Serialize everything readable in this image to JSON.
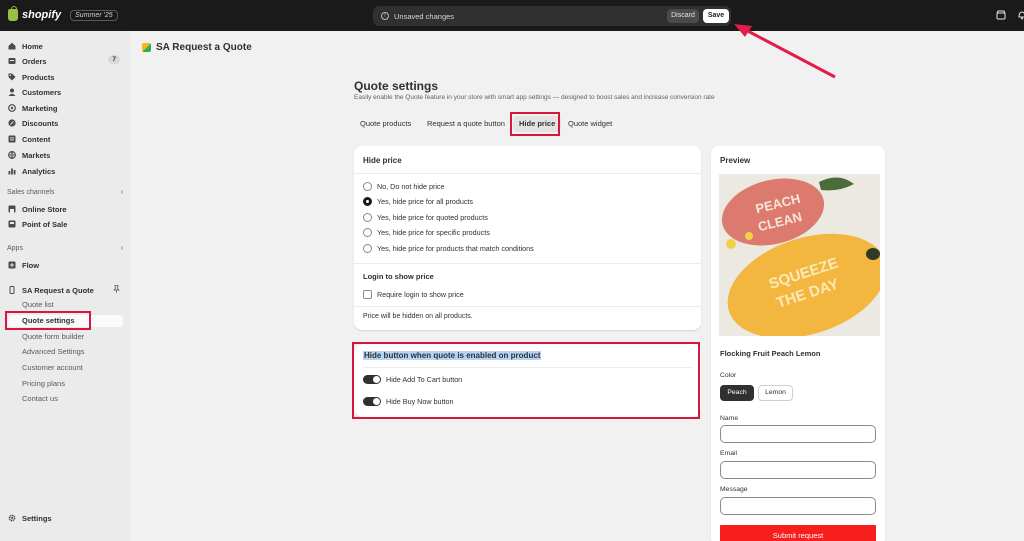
{
  "topbar": {
    "brand": "shopify",
    "season": "Summer '25",
    "unsaved": "Unsaved changes",
    "discard_label": "Discard",
    "save_label": "Save",
    "icons": [
      "store-icon",
      "bell-icon"
    ]
  },
  "sidebar": {
    "items": [
      {
        "label": "Home",
        "icon": "home-icon"
      },
      {
        "label": "Orders",
        "icon": "orders-icon",
        "badge": "7"
      },
      {
        "label": "Products",
        "icon": "tag-icon"
      },
      {
        "label": "Customers",
        "icon": "person-icon"
      },
      {
        "label": "Marketing",
        "icon": "target-icon"
      },
      {
        "label": "Discounts",
        "icon": "discount-icon"
      },
      {
        "label": "Content",
        "icon": "content-icon"
      },
      {
        "label": "Markets",
        "icon": "globe-icon"
      },
      {
        "label": "Analytics",
        "icon": "chart-icon"
      }
    ],
    "sales_channels_label": "Sales channels",
    "channels": [
      {
        "label": "Online Store",
        "icon": "store-icon"
      },
      {
        "label": "Point of Sale",
        "icon": "pos-icon"
      }
    ],
    "apps_label": "Apps",
    "apps": [
      {
        "label": "Flow",
        "icon": "flow-icon"
      }
    ],
    "app_name": "SA Request a Quote",
    "app_subitems": [
      "Quote list",
      "Quote settings",
      "Quote form builder",
      "Advanced Settings",
      "Customer account",
      "Pricing plans",
      "Contact us"
    ],
    "settings_label": "Settings"
  },
  "main": {
    "app_title": "SA Request a Quote",
    "page_title": "Quote settings",
    "page_subtitle": "Easily enable the Quote feature in your store with smart app settings — designed to boost sales and increase conversion rate",
    "tabs": [
      "Quote products",
      "Request a quote button",
      "Hide price",
      "Quote widget"
    ],
    "selected_tab": "Hide price",
    "hide_price": {
      "title": "Hide price",
      "options": [
        "No, Do not hide price",
        "Yes, hide price for all products",
        "Yes, hide price for quoted products",
        "Yes, hide price for specific products",
        "Yes, hide price for products that match conditions"
      ],
      "selected_index": 1,
      "login_title": "Login to show price",
      "login_checkbox": "Require login to show price",
      "note": "Price will be hidden on all products."
    },
    "hide_button": {
      "title": "Hide button when quote is enabled on product",
      "toggles": [
        "Hide Add To Cart button",
        "Hide Buy Now button"
      ]
    }
  },
  "preview": {
    "title": "Preview",
    "product_title": "Flocking Fruit Peach Lemon",
    "color_label": "Color",
    "colors": [
      "Peach",
      "Lemon"
    ],
    "selected_color": "Peach",
    "name_label": "Name",
    "email_label": "Email",
    "message_label": "Message",
    "submit_label": "Submit request",
    "image_text": {
      "peach_line1": "PEACH",
      "peach_line2": "CLEAN",
      "lemon_line1": "SQUEEZE",
      "lemon_line2": "THE DAY"
    }
  },
  "colors": {
    "highlight": "#d6163e",
    "submit": "#f71e1e",
    "topbar": "#1a1a1a"
  }
}
